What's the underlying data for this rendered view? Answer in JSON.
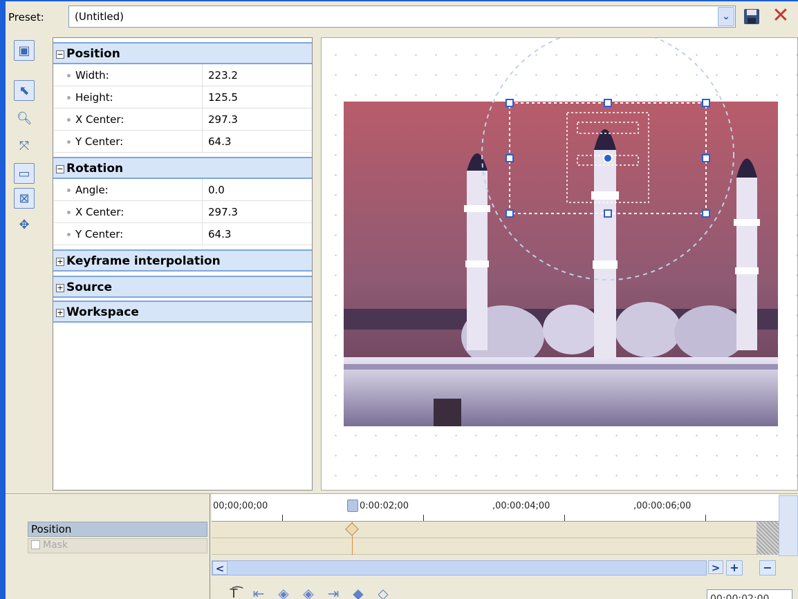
{
  "preset": {
    "label": "Preset:",
    "value": "(Untitled)"
  },
  "toolbar": {
    "dropdown_glyph": "⌄",
    "close_glyph": "✕"
  },
  "tools": [
    "show-properties-icon",
    "pointer-icon",
    "zoom-icon",
    "move-along-icon",
    "fit-icon",
    "fullscreen-icon",
    "pan-icon"
  ],
  "properties": {
    "position": {
      "header": "Position",
      "rows": [
        {
          "label": "Width:",
          "value": "223.2"
        },
        {
          "label": "Height:",
          "value": "125.5"
        },
        {
          "label": "X Center:",
          "value": "297.3"
        },
        {
          "label": "Y Center:",
          "value": "64.3"
        }
      ]
    },
    "rotation": {
      "header": "Rotation",
      "rows": [
        {
          "label": "Angle:",
          "value": "0.0"
        },
        {
          "label": "X Center:",
          "value": "297.3"
        },
        {
          "label": "Y Center:",
          "value": "64.3"
        }
      ]
    },
    "collapsed": [
      "Keyframe interpolation",
      "Source",
      "Workspace"
    ]
  },
  "timeline": {
    "tracks": {
      "position": "Position",
      "mask": "Mask"
    },
    "ruler": [
      "00;00;00;00",
      "0:00:02;00",
      ",00:00:04;00",
      ",00:00:06;00"
    ],
    "timecode": "00:00:02:00",
    "scroll_left": "<",
    "scroll_right": ">",
    "zoom_in": "+",
    "zoom_out": "−"
  }
}
